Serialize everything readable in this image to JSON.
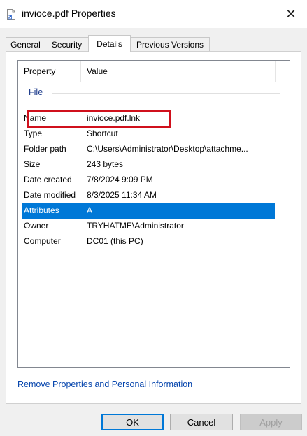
{
  "window": {
    "title": "invioce.pdf Properties",
    "close_symbol": "✕",
    "icon": "shortcut-file-icon"
  },
  "tabs": [
    {
      "label": "General"
    },
    {
      "label": "Security"
    },
    {
      "label": "Details",
      "active": true
    },
    {
      "label": "Previous Versions"
    }
  ],
  "details": {
    "columns": [
      "Property",
      "Value"
    ],
    "group": "File",
    "rows": [
      {
        "property": "Name",
        "value": "invioce.pdf.lnk"
      },
      {
        "property": "Type",
        "value": "Shortcut"
      },
      {
        "property": "Folder path",
        "value": "C:\\Users\\Administrator\\Desktop\\attachme..."
      },
      {
        "property": "Size",
        "value": "243 bytes"
      },
      {
        "property": "Date created",
        "value": "7/8/2024 9:09 PM"
      },
      {
        "property": "Date modified",
        "value": "8/3/2025 11:34 AM"
      },
      {
        "property": "Attributes",
        "value": "A",
        "selected": true
      },
      {
        "property": "Owner",
        "value": "TRYHATME\\Administrator"
      },
      {
        "property": "Computer",
        "value": "DC01 (this PC)"
      }
    ]
  },
  "links": {
    "remove_properties": "Remove Properties and Personal Information"
  },
  "buttons": {
    "ok": "OK",
    "cancel": "Cancel",
    "apply": "Apply"
  },
  "colors": {
    "selection": "#0078d7",
    "annotation_box": "#d0101c",
    "link": "#0645ad"
  }
}
